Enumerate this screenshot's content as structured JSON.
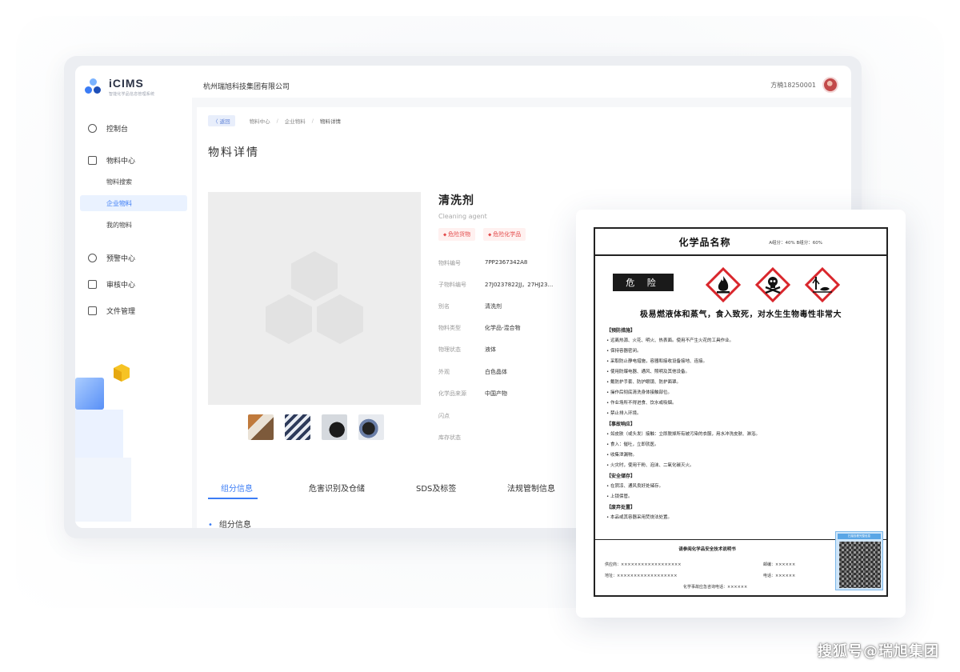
{
  "app": {
    "name": "iCIMS",
    "subtitle": "智能化学品信息管理系统"
  },
  "header": {
    "company": "杭州瑞旭科技集团有限公司",
    "user": "方楠18250001"
  },
  "sidebar": {
    "items": [
      {
        "label": "控制台",
        "icon": "dashboard-icon"
      },
      {
        "label": "物料中心",
        "icon": "cube-icon"
      },
      {
        "label": "物料搜索",
        "sub": true
      },
      {
        "label": "企业物料",
        "sub": true,
        "active": true
      },
      {
        "label": "我的物料",
        "sub": true
      },
      {
        "label": "预警中心",
        "icon": "bell-icon"
      },
      {
        "label": "审核中心",
        "icon": "document-icon"
      },
      {
        "label": "文件管理",
        "icon": "file-icon"
      }
    ]
  },
  "breadcrumb": {
    "back": "〈 返回",
    "items": [
      "物料中心",
      "企业物料",
      "物料详情"
    ]
  },
  "page_title": "物料详情",
  "product": {
    "name": "清洗剂",
    "name_en": "Cleaning agent",
    "tags": [
      "危险货物",
      "危险化学品"
    ],
    "fields": [
      {
        "key": "物料编号",
        "value": "7PP2367342A8"
      },
      {
        "key": "子物料编号",
        "value": "27J0237822JJ，27HJ23…"
      },
      {
        "key": "别名",
        "value": "清洗剂"
      },
      {
        "key": "物料类型",
        "value": "化学品-混合物"
      },
      {
        "key": "物理状态",
        "value": "液体"
      },
      {
        "key": "外观",
        "value": "白色晶体"
      },
      {
        "key": "化学品来源",
        "value": "中国产物"
      },
      {
        "key": "闪点",
        "value": ""
      },
      {
        "key": "库存状态",
        "value": ""
      }
    ]
  },
  "tabs": [
    {
      "label": "组分信息",
      "active": true
    },
    {
      "label": "危害识别及仓储"
    },
    {
      "label": "SDS及标签"
    },
    {
      "label": "法规管制信息"
    }
  ],
  "section_title": "组分信息",
  "label_card": {
    "title": "化学品名称",
    "ratio": "A组分：40%   B组分：60%",
    "signal_word": "危 险",
    "pictograms": [
      "flame-icon",
      "skull-crossbones-icon",
      "environment-icon"
    ],
    "hazard_statement": "极易燃液体和蒸气，食入致死，对水生生物毒性非常大",
    "lines": [
      {
        "text": "【预防措施】",
        "h": true
      },
      {
        "text": "• 远离热源、火花、明火、热表面。使用不产生火花的工具作业。"
      },
      {
        "text": "• 保持容器密闭。"
      },
      {
        "text": "• 采取防止静电措施，容器和接收设备接地、连接。"
      },
      {
        "text": "• 使用防爆电器、通风、照明及其他设备。"
      },
      {
        "text": "• 戴防护手套、防护眼镜、防护面罩。"
      },
      {
        "text": "• 操作后彻底清洗身体接触部位。"
      },
      {
        "text": "• 作业场所不得进食、饮水或吸烟。"
      },
      {
        "text": "• 禁止排入环境。"
      },
      {
        "text": "【事故响应】",
        "h": true
      },
      {
        "text": "• 如皮肤（或头发）接触：立即脱掉所有被污染的衣服，用水冲洗皮肤、淋浴。"
      },
      {
        "text": "• 食入：催吐，立即就医。"
      },
      {
        "text": "• 收集泄漏物。"
      },
      {
        "text": "• 火灾时，使用干粉、泡沫、二氧化碳灭火。"
      },
      {
        "text": "【安全储存】",
        "h": true
      },
      {
        "text": "• 在阴凉、通风良好处储存。"
      },
      {
        "text": "• 上锁保管。"
      },
      {
        "text": "【废弃处置】",
        "h": true
      },
      {
        "text": "• 本品或其容器采用焚烧法处置。"
      }
    ],
    "footer_title": "请参阅化学品安全技术说明书",
    "supplier_label": "供应商：××××××××××××××××××",
    "address_label": "地址：××××××××××××××××××",
    "zip_label": "邮编：××××××",
    "phone_label": "电话：××××××",
    "emergency_label": "化学事故应急咨询电话：××××××",
    "qr_caption": "扫描查看完整信息"
  },
  "colors": {
    "accent": "#3b7cf5",
    "danger": "#e34b4b",
    "ghs_red": "#d9262c"
  },
  "watermark": "搜狐号@瑞旭集团"
}
